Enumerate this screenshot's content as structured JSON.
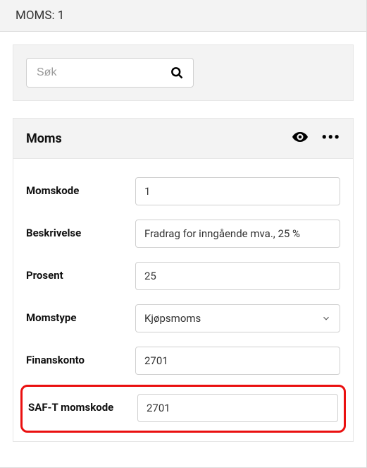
{
  "header": {
    "title": "MOMS: 1"
  },
  "search": {
    "placeholder": "Søk"
  },
  "panel": {
    "title": "Moms"
  },
  "form": {
    "momskode": {
      "label": "Momskode",
      "value": "1"
    },
    "beskrivelse": {
      "label": "Beskrivelse",
      "value": "Fradrag for inngående mva., 25 %"
    },
    "prosent": {
      "label": "Prosent",
      "value": "25"
    },
    "momstype": {
      "label": "Momstype",
      "value": "Kjøpsmoms"
    },
    "finanskonto": {
      "label": "Finanskonto",
      "value": "2701"
    },
    "saft": {
      "label": "SAF-T momskode",
      "value": "2701"
    }
  }
}
